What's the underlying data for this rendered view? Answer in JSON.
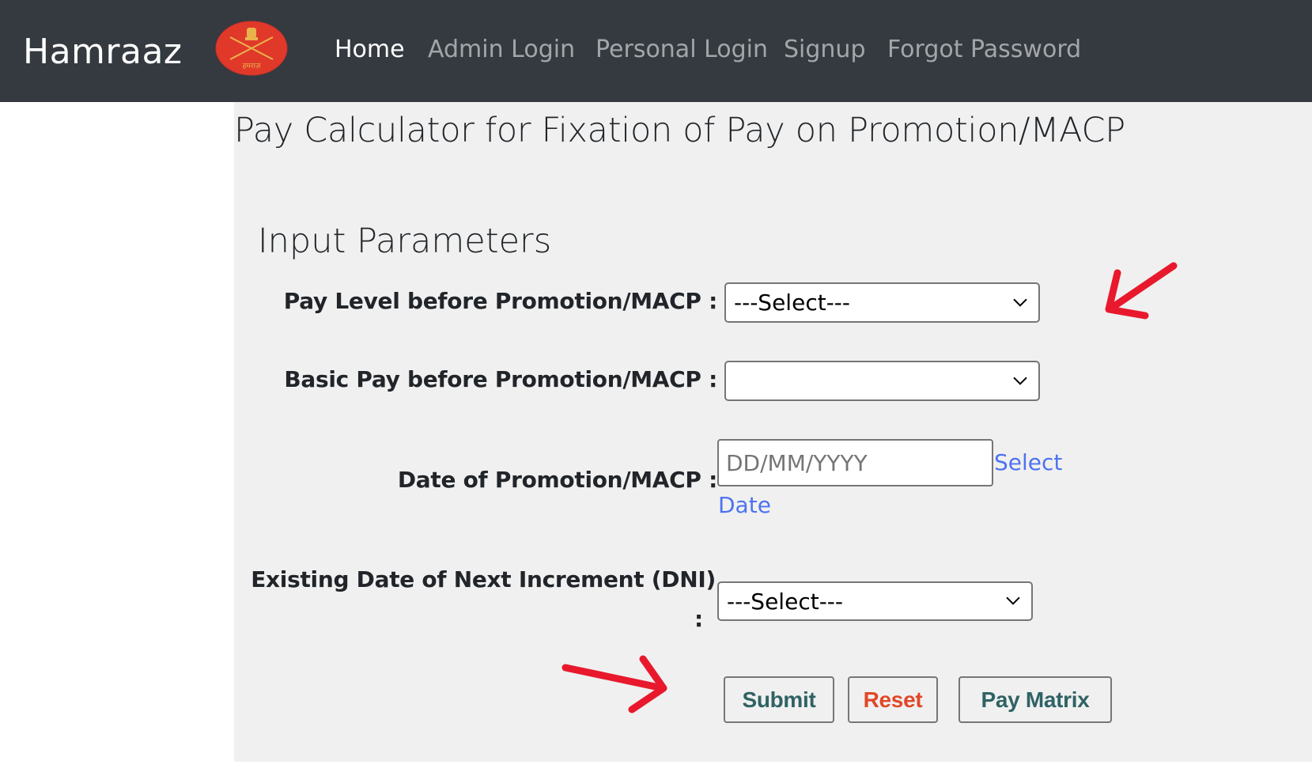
{
  "navbar": {
    "brand": "Hamraaz",
    "logo_text": "हमराज़",
    "items": [
      {
        "label": "Home",
        "active": true
      },
      {
        "label": "Admin Login",
        "active": false
      },
      {
        "label": "Personal Login",
        "active": false
      },
      {
        "label": "Signup",
        "active": false
      },
      {
        "label": "Forgot Password",
        "active": false
      }
    ]
  },
  "page": {
    "title": "Pay Calculator for Fixation of Pay on Promotion/MACP",
    "section_title": "Input Parameters"
  },
  "form": {
    "pay_level": {
      "label": "Pay Level before Promotion/MACP :",
      "value": "---Select---"
    },
    "basic_pay": {
      "label": "Basic Pay before Promotion/MACP :",
      "value": ""
    },
    "promotion_date": {
      "label": "Date of Promotion/MACP :",
      "placeholder": "DD/MM/YYYY",
      "link_line1": "Select",
      "link_line2": "Date"
    },
    "dni": {
      "label_line1": "Existing Date of Next Increment (DNI)",
      "label_line2": ":",
      "value": "---Select---"
    }
  },
  "buttons": {
    "submit": "Submit",
    "reset": "Reset",
    "pay_matrix": "Pay Matrix"
  },
  "colors": {
    "navbar": "#343a40",
    "panel": "#f0f0f0",
    "link": "#4f72f0",
    "teal_button_text": "#2f6264",
    "reset_text": "#e04828",
    "annotation_arrow": "#e8192c"
  }
}
